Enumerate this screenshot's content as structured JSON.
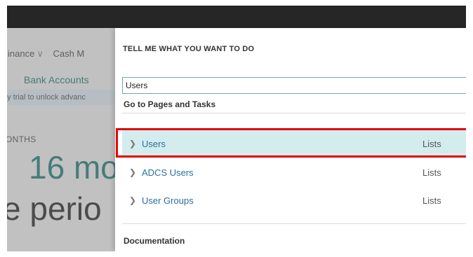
{
  "background": {
    "nav": [
      "inance",
      "Cash M"
    ],
    "bank_accounts": "Bank Accounts",
    "trial_banner": "ay trial to unlock advanc",
    "months_label": "ONTHS",
    "big_value": "16 mo",
    "big_period": "e perio"
  },
  "panel": {
    "title": "TELL ME WHAT YOU WANT TO DO",
    "search_value": "Users",
    "section_pages": "Go to Pages and Tasks",
    "results": [
      {
        "label": "Users",
        "category": "Lists"
      },
      {
        "label": "ADCS Users",
        "category": "Lists"
      },
      {
        "label": "User Groups",
        "category": "Lists"
      }
    ],
    "section_docs": "Documentation"
  },
  "colors": {
    "accent": "#2c7d7b",
    "highlight": "#e00000",
    "selected_row": "#d3eced"
  }
}
